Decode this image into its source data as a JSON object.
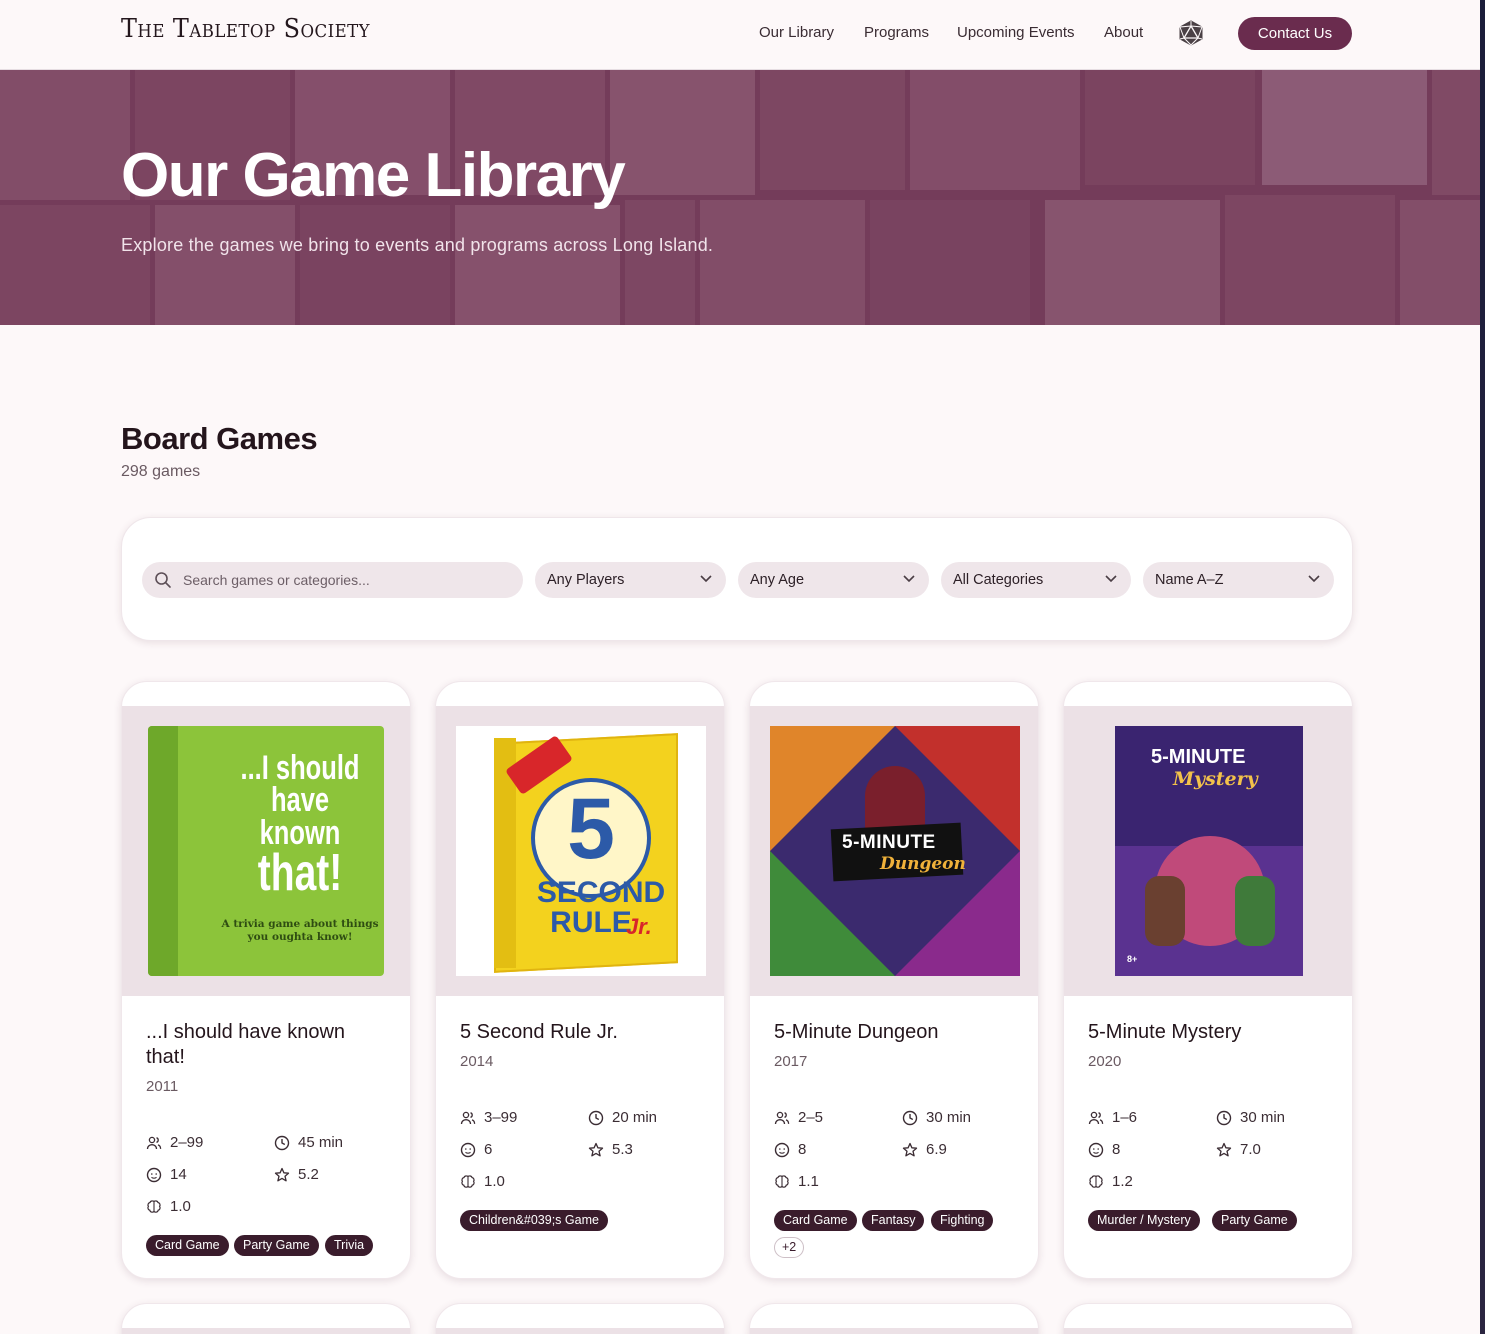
{
  "header": {
    "brand": "The Tabletop Society",
    "nav": [
      "Our Library",
      "Programs",
      "Upcoming Events",
      "About"
    ],
    "dice_icon": "d20-icon",
    "contact_label": "Contact Us"
  },
  "hero": {
    "title": "Our Game Library",
    "subtitle": "Explore the games we bring to events and programs across Long Island."
  },
  "section": {
    "title": "Board Games",
    "count": "298 games"
  },
  "filters": {
    "search_placeholder": "Search games or categories...",
    "players": "Any Players",
    "age": "Any Age",
    "category": "All Categories",
    "sort": "Name A–Z"
  },
  "games": [
    {
      "title": "...I should have known that!",
      "year": "2011",
      "players": "2–99",
      "time": "45 min",
      "age": "14",
      "rating": "5.2",
      "weight": "1.0",
      "tags": [
        "Card Game",
        "Party Game",
        "Trivia"
      ],
      "cover_text": [
        "...I should",
        "have known",
        "that!",
        "A trivia game about things you oughta know!"
      ]
    },
    {
      "title": "5 Second Rule Jr.",
      "year": "2014",
      "players": "3–99",
      "time": "20 min",
      "age": "6",
      "rating": "5.3",
      "weight": "1.0",
      "tags": [
        "Children&#039;s Game"
      ],
      "cover_text": [
        "5",
        "SECOND",
        "RULE",
        "Jr."
      ]
    },
    {
      "title": "5-Minute Dungeon",
      "year": "2017",
      "players": "2–5",
      "time": "30 min",
      "age": "8",
      "rating": "6.9",
      "weight": "1.1",
      "tags": [
        "Card Game",
        "Fantasy",
        "Fighting"
      ],
      "more": "+2",
      "cover_text": [
        "5-MINUTE",
        "Dungeon"
      ]
    },
    {
      "title": "5-Minute Mystery",
      "year": "2020",
      "players": "1–6",
      "time": "30 min",
      "age": "8",
      "rating": "7.0",
      "weight": "1.2",
      "tags": [
        "Murder / Mystery",
        "Party Game"
      ],
      "cover_text": [
        "5-MINUTE",
        "Mystery",
        "8+"
      ]
    }
  ],
  "icons": {
    "players": "users-icon",
    "time": "clock-icon",
    "age": "age-face-icon",
    "rating": "star-icon",
    "weight": "brain-icon",
    "search": "search-icon",
    "chevron": "chevron-down-icon"
  },
  "colors": {
    "brand": "#6a2c4e",
    "hero_tint": "#703454",
    "tag_bg": "#3a1c2c",
    "page_bg": "#fdf8f9"
  }
}
